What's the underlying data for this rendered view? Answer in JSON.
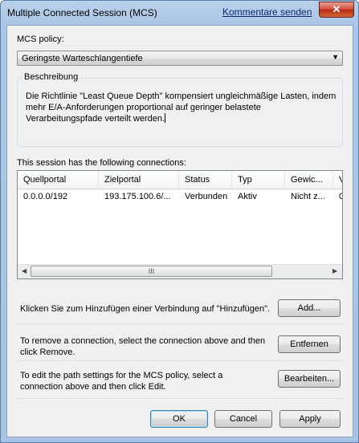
{
  "window": {
    "title": "Multiple Connected Session (MCS)",
    "help_link": "Kommentare senden",
    "close_glyph": "✕"
  },
  "policy": {
    "label": "MCS policy:",
    "selected": "Geringste Warteschlangentiefe"
  },
  "description": {
    "label": "Beschreibung",
    "text": "Die Richtlinie \"Least Queue Depth\" kompensiert ungleichmäßige Lasten, indem mehr E/A-Anforderungen proportional auf geringer belastete Verarbeitungspfade verteilt werden."
  },
  "connections": {
    "label": "This session has the following connections:",
    "columns": [
      "Quellportal",
      "Zielportal",
      "Status",
      "Typ",
      "Gewic...",
      "V"
    ],
    "rows": [
      [
        "0.0.0.0/192",
        "193.175.100.6/...",
        "Verbunden",
        "Aktiv",
        "Nicht z...",
        "0"
      ]
    ],
    "scroll_grip": "III"
  },
  "actions": {
    "add_text": "Klicken Sie zum Hinzufügen einer Verbindung auf \"Hinzufügen\".",
    "add_button": "Add...",
    "remove_text": "To remove a connection, select the connection above and then click Remove.",
    "remove_button": "Entfernen",
    "edit_text": "To edit the path settings for the MCS policy, select a connection above and then click Edit.",
    "edit_button": "Bearbeiten..."
  },
  "footer": {
    "ok": "OK",
    "cancel": "Cancel",
    "apply": "Apply"
  }
}
